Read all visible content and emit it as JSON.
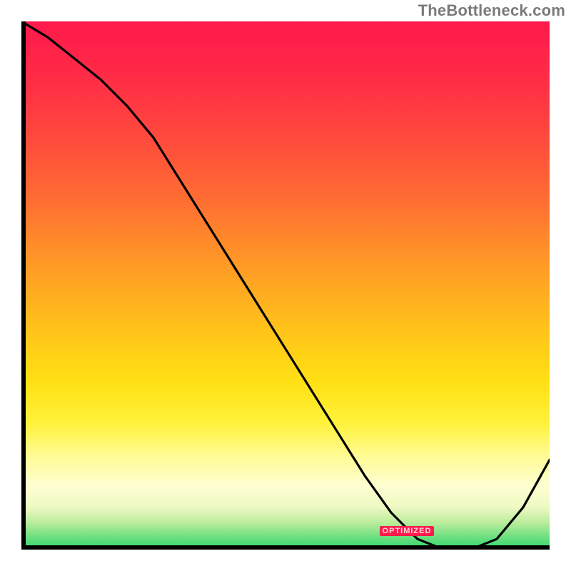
{
  "watermark": "TheBottleneck.com",
  "chart_data": {
    "type": "line",
    "title": "",
    "xlabel": "",
    "ylabel": "",
    "xlim": [
      0,
      100
    ],
    "ylim": [
      0,
      100
    ],
    "grid": false,
    "legend": false,
    "series": [
      {
        "name": "bottleneck-curve",
        "x": [
          0,
          5,
          10,
          15,
          20,
          25,
          30,
          35,
          40,
          45,
          50,
          55,
          60,
          65,
          70,
          75,
          80,
          85,
          90,
          95,
          100
        ],
        "values": [
          100,
          97,
          93,
          89,
          84,
          78,
          70,
          62,
          54,
          46,
          38,
          30,
          22,
          14,
          7,
          2,
          0,
          0,
          2,
          8,
          17
        ]
      }
    ],
    "optimal_range_x": [
      78,
      88
    ],
    "annotation_label": "OPTIMIZED",
    "background_gradient_stops": [
      {
        "pos": 0.0,
        "color": "#ff1a4b"
      },
      {
        "pos": 0.5,
        "color": "#ffb020"
      },
      {
        "pos": 0.8,
        "color": "#fff23a"
      },
      {
        "pos": 0.95,
        "color": "#b8ec9a"
      },
      {
        "pos": 1.0,
        "color": "#2fd86e"
      }
    ]
  }
}
